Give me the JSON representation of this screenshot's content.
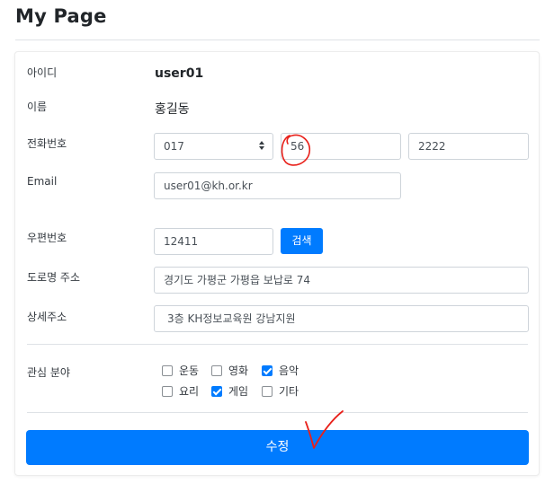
{
  "page": {
    "title": "My Page"
  },
  "form": {
    "id_label": "아이디",
    "id_value": "user01",
    "name_label": "이름",
    "name_value": "홍길동",
    "phone_label": "전화번호",
    "phone_prefix": "017",
    "phone_mid": "56",
    "phone_last": "2222",
    "email_label": "Email",
    "email_value": "user01@kh.or.kr",
    "zipcode_label": "우편번호",
    "zipcode_value": "12411",
    "search_label": "검색",
    "road_address_label": "도로명 주소",
    "road_address_value": "경기도 가평군 가평읍 보납로 74",
    "detail_address_label": "상세주소",
    "detail_address_value": "3층 KH정보교육원 강남지원",
    "interests_label": "관심 분야",
    "interests": [
      {
        "label": "운동",
        "checked": false
      },
      {
        "label": "영화",
        "checked": false
      },
      {
        "label": "음악",
        "checked": true
      },
      {
        "label": "요리",
        "checked": false
      },
      {
        "label": "게임",
        "checked": true
      },
      {
        "label": "기타",
        "checked": false
      }
    ],
    "submit_label": "수정"
  },
  "colors": {
    "accent": "#007bff",
    "annotation": "#e8201a"
  }
}
